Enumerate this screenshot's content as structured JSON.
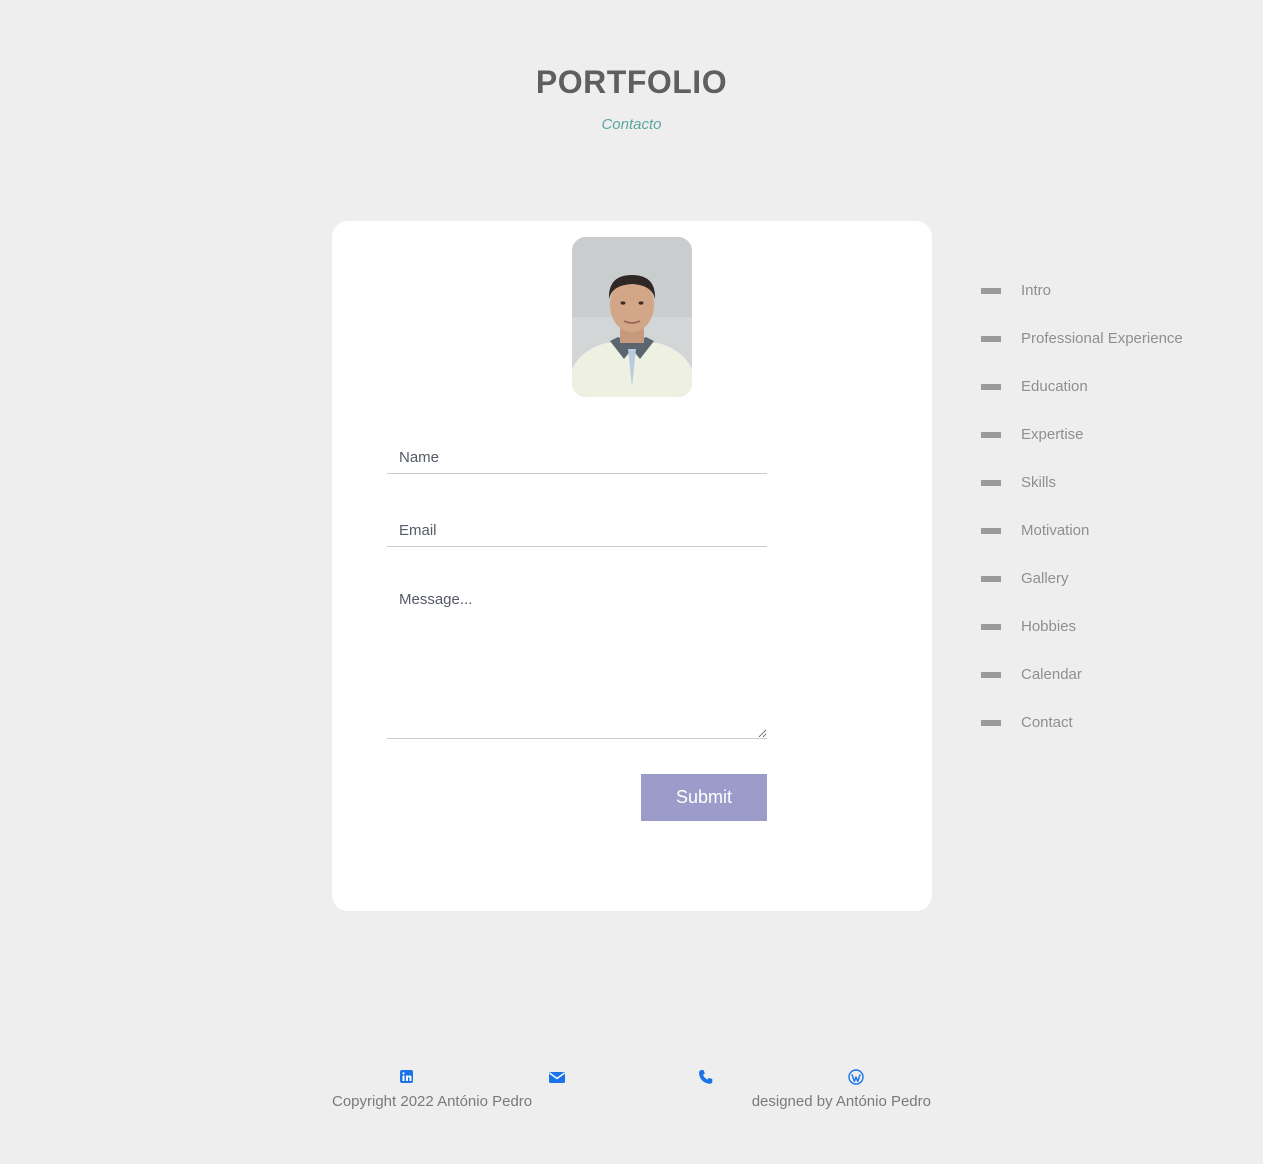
{
  "header": {
    "title": "PORTFOLIO",
    "subtitle": "Contacto"
  },
  "contact_form": {
    "name_placeholder": "Name",
    "email_placeholder": "Email",
    "message_placeholder": "Message...",
    "submit_label": "Submit",
    "submit_color": "#9c9ccb"
  },
  "side_nav": {
    "items": [
      {
        "label": "Intro"
      },
      {
        "label": "Professional Experience"
      },
      {
        "label": "Education"
      },
      {
        "label": "Expertise"
      },
      {
        "label": "Skills"
      },
      {
        "label": "Motivation"
      },
      {
        "label": "Gallery"
      },
      {
        "label": "Hobbies"
      },
      {
        "label": "Calendar"
      },
      {
        "label": "Contact"
      }
    ]
  },
  "footer": {
    "copyright": "Copyright 2022 António Pedro",
    "designed_by": "designed by António Pedro",
    "icons": [
      "linkedin-icon",
      "envelope-icon",
      "phone-icon",
      "wordpress-icon"
    ],
    "icon_color": "#1a73e8"
  }
}
